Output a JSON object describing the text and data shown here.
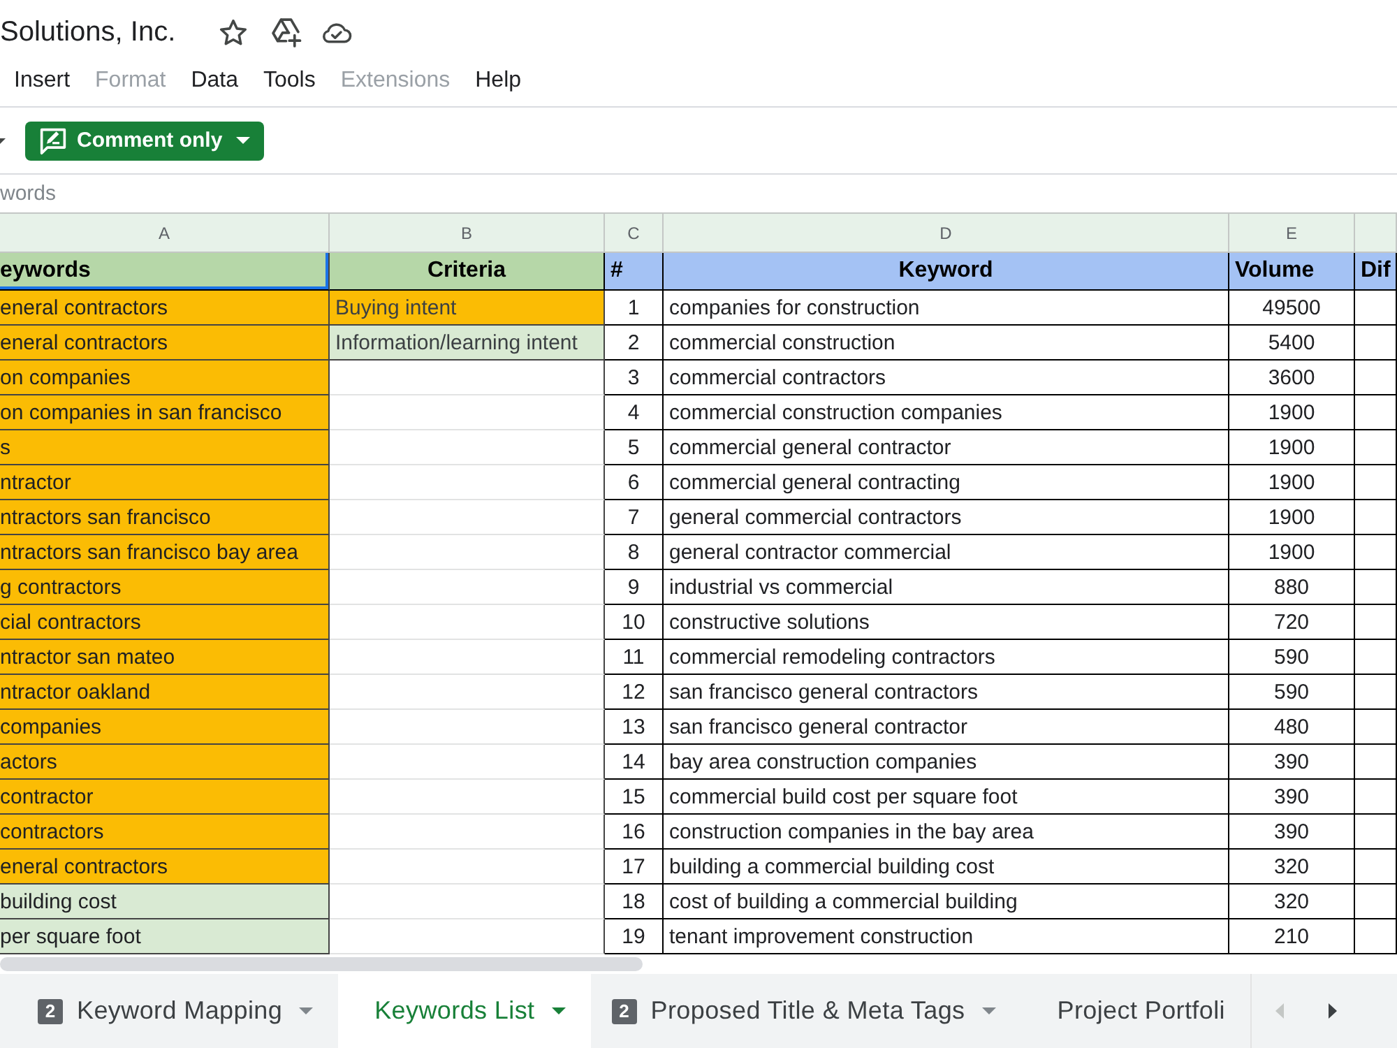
{
  "document": {
    "title": "Solutions, Inc."
  },
  "menu": [
    {
      "label": "Insert",
      "disabled": false
    },
    {
      "label": "Format",
      "disabled": true
    },
    {
      "label": "Data",
      "disabled": false
    },
    {
      "label": "Tools",
      "disabled": false
    },
    {
      "label": "Extensions",
      "disabled": true
    },
    {
      "label": "Help",
      "disabled": false
    }
  ],
  "toolbar": {
    "mode_button": "Comment only"
  },
  "formula_bar": {
    "range_name": "words"
  },
  "sheet": {
    "column_letters": [
      "A",
      "B",
      "C",
      "D",
      "E"
    ],
    "header": [
      {
        "text": "eywords",
        "color": "#b6d7a8",
        "selected": true
      },
      {
        "text": "Criteria",
        "color": "#b6d7a8",
        "selected": false
      },
      {
        "text": "#",
        "color": "#a4c2f4",
        "selected": false
      },
      {
        "text": "Keyword",
        "color": "#a4c2f4",
        "selected": false
      },
      {
        "text": "Volume",
        "color": "#a4c2f4",
        "selected": false
      },
      {
        "text": "Dif",
        "color": "#a4c2f4",
        "selected": false
      }
    ],
    "rows": [
      {
        "column_a": {
          "text": "eneral contractors",
          "color": "#fbbc04"
        },
        "criteria": {
          "text": "Buying intent",
          "color": "#fbbc04"
        },
        "number": "1",
        "keyword": "companies for construction",
        "volume": "49500"
      },
      {
        "column_a": {
          "text": "eneral contractors",
          "color": "#fbbc04"
        },
        "criteria": {
          "text": "Information/learning intent",
          "color": "#d9ead3"
        },
        "number": "2",
        "keyword": "commercial construction",
        "volume": "5400"
      },
      {
        "column_a": {
          "text": "on companies",
          "color": "#fbbc04"
        },
        "number": "3",
        "keyword": "commercial contractors",
        "volume": "3600"
      },
      {
        "column_a": {
          "text": "on companies in san francisco",
          "color": "#fbbc04"
        },
        "number": "4",
        "keyword": "commercial construction companies",
        "volume": "1900"
      },
      {
        "column_a": {
          "text": "s",
          "color": "#fbbc04"
        },
        "number": "5",
        "keyword": "commercial general contractor",
        "volume": "1900"
      },
      {
        "column_a": {
          "text": "ntractor",
          "color": "#fbbc04"
        },
        "number": "6",
        "keyword": "commercial general contracting",
        "volume": "1900"
      },
      {
        "column_a": {
          "text": "ntractors san francisco",
          "color": "#fbbc04"
        },
        "number": "7",
        "keyword": "general commercial contractors",
        "volume": "1900"
      },
      {
        "column_a": {
          "text": "ntractors san francisco bay area",
          "color": "#fbbc04"
        },
        "number": "8",
        "keyword": "general contractor commercial",
        "volume": "1900"
      },
      {
        "column_a": {
          "text": "g contractors",
          "color": "#fbbc04"
        },
        "number": "9",
        "keyword": "industrial vs commercial",
        "volume": "880"
      },
      {
        "column_a": {
          "text": "cial contractors",
          "color": "#fbbc04"
        },
        "number": "10",
        "keyword": "constructive solutions",
        "volume": "720"
      },
      {
        "column_a": {
          "text": "ntractor san mateo",
          "color": "#fbbc04"
        },
        "number": "11",
        "keyword": "commercial remodeling contractors",
        "volume": "590"
      },
      {
        "column_a": {
          "text": "ntractor oakland",
          "color": "#fbbc04"
        },
        "number": "12",
        "keyword": "san francisco general contractors",
        "volume": "590"
      },
      {
        "column_a": {
          "text": "companies",
          "color": "#fbbc04"
        },
        "number": "13",
        "keyword": "san francisco general contractor",
        "volume": "480"
      },
      {
        "column_a": {
          "text": "actors",
          "color": "#fbbc04"
        },
        "number": "14",
        "keyword": "bay area construction companies",
        "volume": "390"
      },
      {
        "column_a": {
          "text": "contractor",
          "color": "#fbbc04"
        },
        "number": "15",
        "keyword": "commercial build cost per square foot",
        "volume": "390"
      },
      {
        "column_a": {
          "text": "contractors",
          "color": "#fbbc04"
        },
        "number": "16",
        "keyword": "construction companies in the bay area",
        "volume": "390"
      },
      {
        "column_a": {
          "text": "eneral contractors",
          "color": "#fbbc04"
        },
        "number": "17",
        "keyword": "building a commercial building cost",
        "volume": "320"
      },
      {
        "column_a": {
          "text": "building cost",
          "color": "#d9ead3"
        },
        "number": "18",
        "keyword": "cost of building a commercial building",
        "volume": "320"
      },
      {
        "column_a": {
          "text": "per square foot",
          "color": "#d9ead3"
        },
        "number": "19",
        "keyword": "tenant improvement construction",
        "volume": "210"
      }
    ]
  },
  "sheet_tabs": {
    "tabs": [
      {
        "label": "Keyword Mapping",
        "badge": "2",
        "dropdown": true,
        "selected": false
      },
      {
        "label": "Keywords List",
        "dropdown": true,
        "selected": true
      },
      {
        "label": "Proposed Title & Meta Tags",
        "badge": "2",
        "dropdown": true,
        "selected": false
      },
      {
        "label": "Project Portfoli",
        "dropdown": false,
        "selected": false
      }
    ],
    "scroll_buttons": [
      {
        "kind": "left",
        "disabled": true
      },
      {
        "kind": "right",
        "disabled": false
      }
    ]
  }
}
